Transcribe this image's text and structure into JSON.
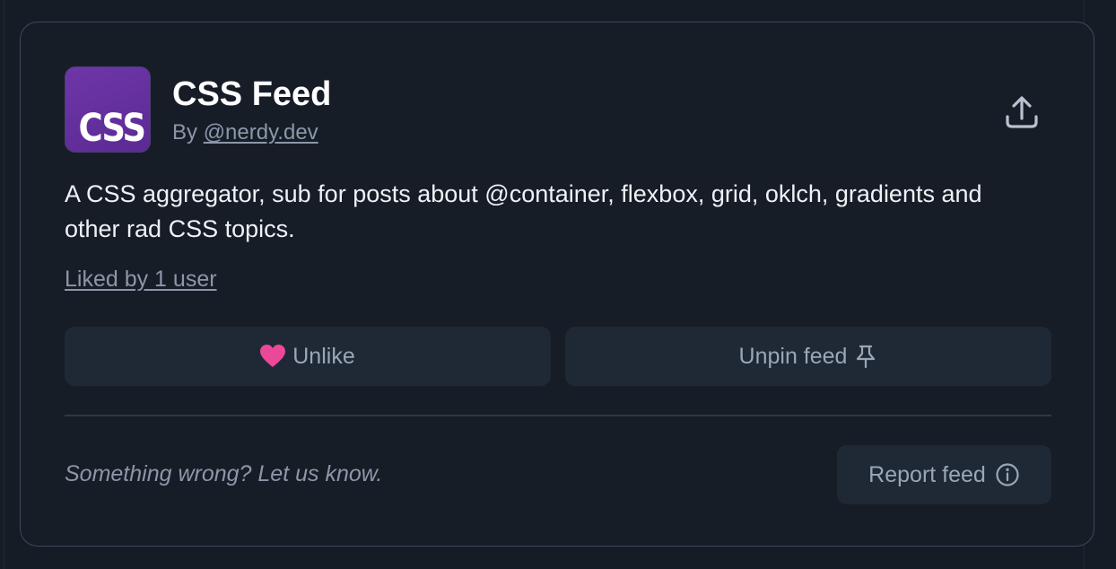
{
  "feed": {
    "avatar_text": "CSS",
    "title": "CSS Feed",
    "by_prefix": "By",
    "author": "@nerdy.dev",
    "description": "A CSS aggregator, sub for posts about @container, flexbox, grid, oklch, gradients and other rad CSS topics.",
    "liked_by": "Liked by 1 user"
  },
  "actions": {
    "unlike_label": "Unlike",
    "unpin_label": "Unpin feed",
    "share_icon": "share-upload-icon",
    "heart_icon": "heart-icon",
    "pin_icon": "pin-icon"
  },
  "footer": {
    "note": "Something wrong? Let us know.",
    "report_label": "Report feed",
    "report_icon": "info-circle-icon"
  },
  "colors": {
    "background": "#161c26",
    "card_border": "#3a4a5c",
    "button_bg": "#1f2935",
    "heart": "#ec4899",
    "avatar": "#6e36a8"
  }
}
